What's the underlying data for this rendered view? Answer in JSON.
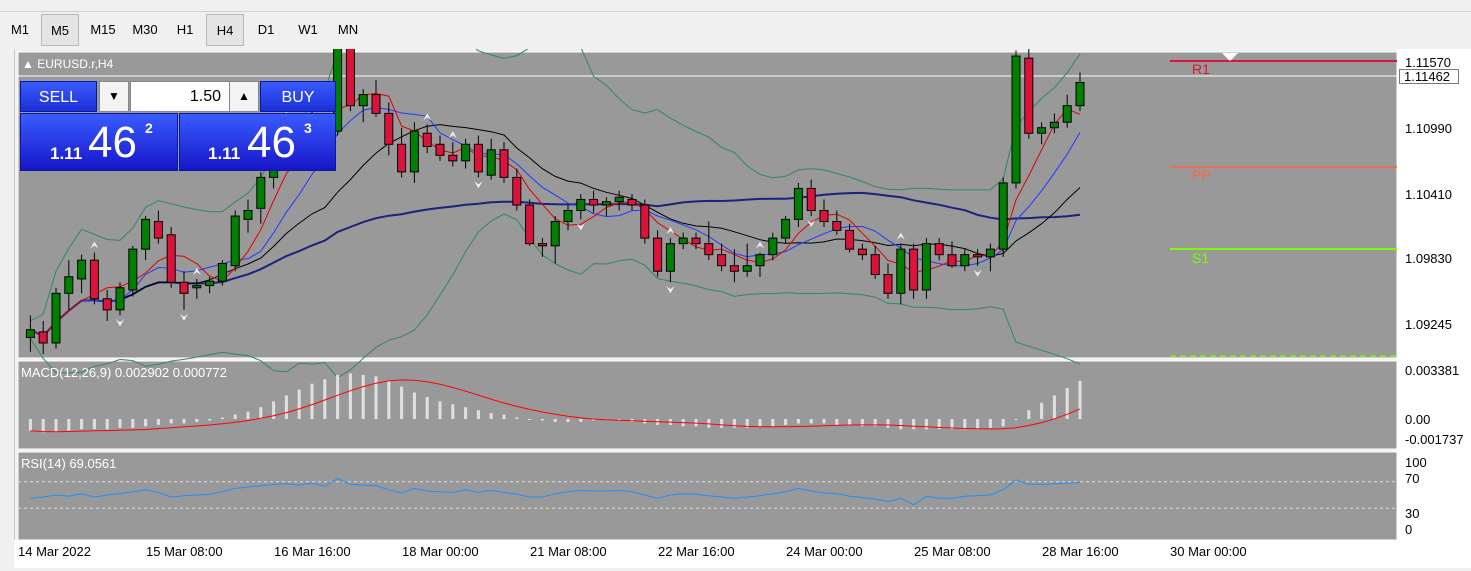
{
  "timeframes": [
    "M1",
    "M5",
    "M15",
    "M30",
    "H1",
    "H4",
    "D1",
    "W1",
    "MN"
  ],
  "active_timeframes": [
    "M5",
    "H4"
  ],
  "chart": {
    "symbol_title": "EURUSD.r,H4"
  },
  "trade_panel": {
    "sell_label": "SELL",
    "buy_label": "BUY",
    "lot": "1.50",
    "sell_price": {
      "small": "1.11",
      "big": "46",
      "sup": "2"
    },
    "buy_price": {
      "small": "1.11",
      "big": "46",
      "sup": "3"
    },
    "arrow_down": "▼",
    "arrow_up": "▲"
  },
  "price_axis": [
    "1.11570",
    "1.10990",
    "1.10410",
    "1.09830",
    "1.09245"
  ],
  "current_price": "1.11462",
  "levels": {
    "r1": "R1",
    "pp": "PP",
    "s1": "S1"
  },
  "time_axis": [
    "14 Mar 2022",
    "15 Mar 08:00",
    "16 Mar 16:00",
    "18 Mar 00:00",
    "21 Mar 08:00",
    "22 Mar 16:00",
    "24 Mar 00:00",
    "25 Mar 08:00",
    "28 Mar 16:00",
    "30 Mar 00:00"
  ],
  "macd": {
    "label": "MACD(12,26,9) 0.002902 0.000772",
    "axis": [
      "0.003381",
      "0.00",
      "-0.001737"
    ]
  },
  "rsi": {
    "label": "RSI(14) 69.0561",
    "axis": [
      "100",
      "70",
      "30",
      "0"
    ]
  },
  "colors": {
    "chart_bg": "#999999",
    "bull": "#008000",
    "bear": "#dc143c",
    "r1": "#dc143c",
    "pp": "#ff6347",
    "s1": "#7cfc00",
    "macd_signal": "#ff0000",
    "rsi_line": "#1e90ff",
    "trade_blue": "#2040f0"
  },
  "chart_data": {
    "type": "candlestick",
    "candles": [
      [
        1.0915,
        1.0935,
        1.0902,
        1.0922
      ],
      [
        1.092,
        1.093,
        1.09,
        1.091
      ],
      [
        1.091,
        1.096,
        1.0905,
        1.0955
      ],
      [
        1.0955,
        1.0985,
        1.094,
        1.097
      ],
      [
        1.0968,
        1.099,
        1.0955,
        1.0985
      ],
      [
        1.0985,
        1.0992,
        1.0945,
        1.095
      ],
      [
        1.095,
        1.0958,
        1.093,
        1.094
      ],
      [
        1.094,
        1.0965,
        1.0935,
        1.096
      ],
      [
        1.0958,
        1.0998,
        1.0952,
        1.0995
      ],
      [
        1.0995,
        1.1025,
        1.0985,
        1.1022
      ],
      [
        1.102,
        1.103,
        1.1,
        1.1005
      ],
      [
        1.1008,
        1.1015,
        1.096,
        1.0965
      ],
      [
        1.0965,
        1.0975,
        1.094,
        1.0955
      ],
      [
        1.096,
        1.0968,
        1.095,
        1.0962
      ],
      [
        1.0962,
        1.097,
        1.0955,
        1.0966
      ],
      [
        1.0966,
        1.0985,
        1.0962,
        1.0982
      ],
      [
        1.098,
        1.103,
        1.0975,
        1.1025
      ],
      [
        1.1022,
        1.104,
        1.101,
        1.103
      ],
      [
        1.1032,
        1.1065,
        1.1018,
        1.106
      ],
      [
        1.106,
        1.11,
        1.105,
        1.1098
      ],
      [
        1.1095,
        1.111,
        1.108,
        1.1105
      ],
      [
        1.1108,
        1.1115,
        1.1085,
        1.109
      ],
      [
        1.109,
        1.112,
        1.1082,
        1.1112
      ],
      [
        1.111,
        1.1115,
        1.1095,
        1.1102
      ],
      [
        1.1102,
        1.1205,
        1.1098,
        1.12
      ],
      [
        1.1202,
        1.1225,
        1.112,
        1.1125
      ],
      [
        1.1125,
        1.114,
        1.111,
        1.1135
      ],
      [
        1.1135,
        1.1148,
        1.1115,
        1.1118
      ],
      [
        1.1118,
        1.1128,
        1.108,
        1.109
      ],
      [
        1.109,
        1.1105,
        1.106,
        1.1065
      ],
      [
        1.1065,
        1.111,
        1.1055,
        1.1102
      ],
      [
        1.11,
        1.1108,
        1.1082,
        1.1088
      ],
      [
        1.109,
        1.1098,
        1.1075,
        1.108
      ],
      [
        1.108,
        1.1092,
        1.107,
        1.1075
      ],
      [
        1.1075,
        1.1095,
        1.1068,
        1.109
      ],
      [
        1.109,
        1.1098,
        1.106,
        1.1065
      ],
      [
        1.1062,
        1.1095,
        1.1058,
        1.1085
      ],
      [
        1.1085,
        1.1092,
        1.1055,
        1.106
      ],
      [
        1.106,
        1.1068,
        1.103,
        1.1035
      ],
      [
        1.1035,
        1.104,
        1.0998,
        1.1
      ],
      [
        1.1,
        1.1005,
        1.0988,
        1.0998
      ],
      [
        1.0998,
        1.1025,
        1.0982,
        1.102
      ],
      [
        1.102,
        1.1035,
        1.1012,
        1.103
      ],
      [
        1.103,
        1.1045,
        1.1022,
        1.104
      ],
      [
        1.104,
        1.1048,
        1.1028,
        1.1035
      ],
      [
        1.1035,
        1.1042,
        1.1025,
        1.1038
      ],
      [
        1.1038,
        1.1048,
        1.103,
        1.1042
      ],
      [
        1.104,
        1.1045,
        1.103,
        1.1035
      ],
      [
        1.1035,
        1.104,
        1.1,
        1.1005
      ],
      [
        1.1005,
        1.1012,
        1.097,
        1.0975
      ],
      [
        1.0975,
        1.1005,
        1.0965,
        1.1
      ],
      [
        1.1,
        1.101,
        1.0995,
        1.1005
      ],
      [
        1.1005,
        1.101,
        1.0995,
        1.1
      ],
      [
        1.1,
        1.102,
        1.0985,
        1.099
      ],
      [
        1.099,
        1.1,
        1.0975,
        1.098
      ],
      [
        1.098,
        1.0995,
        1.0965,
        1.0975
      ],
      [
        1.0975,
        1.1,
        1.097,
        1.098
      ],
      [
        1.098,
        1.0992,
        1.097,
        1.099
      ],
      [
        1.099,
        1.101,
        1.0985,
        1.1005
      ],
      [
        1.1005,
        1.1025,
        1.1,
        1.1022
      ],
      [
        1.1022,
        1.1055,
        1.1015,
        1.105
      ],
      [
        1.105,
        1.1058,
        1.1025,
        1.103
      ],
      [
        1.103,
        1.104,
        1.1015,
        1.102
      ],
      [
        1.102,
        1.103,
        1.1008,
        1.1012
      ],
      [
        1.1012,
        1.1018,
        1.0992,
        1.0995
      ],
      [
        1.0995,
        1.1,
        1.0985,
        1.099
      ],
      [
        1.099,
        1.0998,
        1.0968,
        1.0972
      ],
      [
        1.0972,
        1.0982,
        1.095,
        1.0955
      ],
      [
        1.0955,
        1.1,
        1.0945,
        1.0995
      ],
      [
        1.0995,
        1.1,
        1.095,
        1.0958
      ],
      [
        1.0958,
        1.1005,
        1.095,
        1.1
      ],
      [
        1.1,
        1.1005,
        1.0985,
        1.099
      ],
      [
        1.099,
        1.1002,
        1.0978,
        1.098
      ],
      [
        1.098,
        1.0995,
        1.0975,
        1.099
      ],
      [
        1.099,
        1.0995,
        1.098,
        1.0988
      ],
      [
        1.0988,
        1.1,
        1.0975,
        1.0995
      ],
      [
        1.0995,
        1.106,
        1.0988,
        1.1055
      ],
      [
        1.1055,
        1.1175,
        1.105,
        1.117
      ],
      [
        1.1168,
        1.1185,
        1.1095,
        1.11
      ],
      [
        1.11,
        1.111,
        1.109,
        1.1105
      ],
      [
        1.1105,
        1.1118,
        1.11,
        1.111
      ],
      [
        1.111,
        1.1135,
        1.1105,
        1.1125
      ],
      [
        1.1125,
        1.1155,
        1.112,
        1.1146
      ]
    ],
    "macd_hist": [
      -0.0008,
      -0.0009,
      -0.0009,
      -0.0008,
      -0.0007,
      -0.0007,
      -0.0007,
      -0.0006,
      -0.0006,
      -0.0005,
      -0.0004,
      -0.0003,
      -0.0003,
      -0.0002,
      -0.0001,
      0.0001,
      0.0003,
      0.0005,
      0.0008,
      0.0012,
      0.0016,
      0.002,
      0.0024,
      0.0027,
      0.003,
      0.0031,
      0.003,
      0.0029,
      0.0026,
      0.0022,
      0.0018,
      0.0015,
      0.0012,
      0.001,
      0.0008,
      0.0006,
      0.0004,
      0.0003,
      0.0001,
      0.0,
      -0.0001,
      -0.0002,
      -0.0002,
      -0.0002,
      -0.0001,
      0.0,
      -0.0001,
      -0.0002,
      -0.0003,
      -0.0004,
      -0.0004,
      -0.0005,
      -0.0005,
      -0.0006,
      -0.0006,
      -0.0006,
      -0.0006,
      -0.0005,
      -0.0005,
      -0.0004,
      -0.0003,
      -0.0003,
      -0.0003,
      -0.0004,
      -0.0004,
      -0.0005,
      -0.0005,
      -0.0006,
      -0.0007,
      -0.0007,
      -0.0007,
      -0.0007,
      -0.0007,
      -0.0007,
      -0.0007,
      -0.0006,
      -0.0005,
      0.0,
      0.0006,
      0.0011,
      0.0016,
      0.0021,
      0.0026
    ],
    "rsi": [
      45,
      47,
      50,
      48,
      52,
      47,
      50,
      52,
      55,
      58,
      54,
      47,
      49,
      50,
      51,
      55,
      60,
      62,
      64,
      66,
      67,
      65,
      68,
      63,
      75,
      66,
      65,
      64,
      58,
      53,
      60,
      56,
      55,
      54,
      58,
      54,
      57,
      54,
      51,
      47,
      47,
      52,
      55,
      57,
      56,
      56,
      57,
      55,
      50,
      45,
      50,
      52,
      51,
      49,
      47,
      45,
      47,
      49,
      52,
      55,
      60,
      56,
      53,
      52,
      48,
      46,
      44,
      40,
      45,
      35,
      48,
      45,
      45,
      48,
      49,
      50,
      58,
      73,
      66,
      66,
      67,
      68,
      69
    ],
    "price_range": [
      1.09,
      1.117
    ]
  }
}
